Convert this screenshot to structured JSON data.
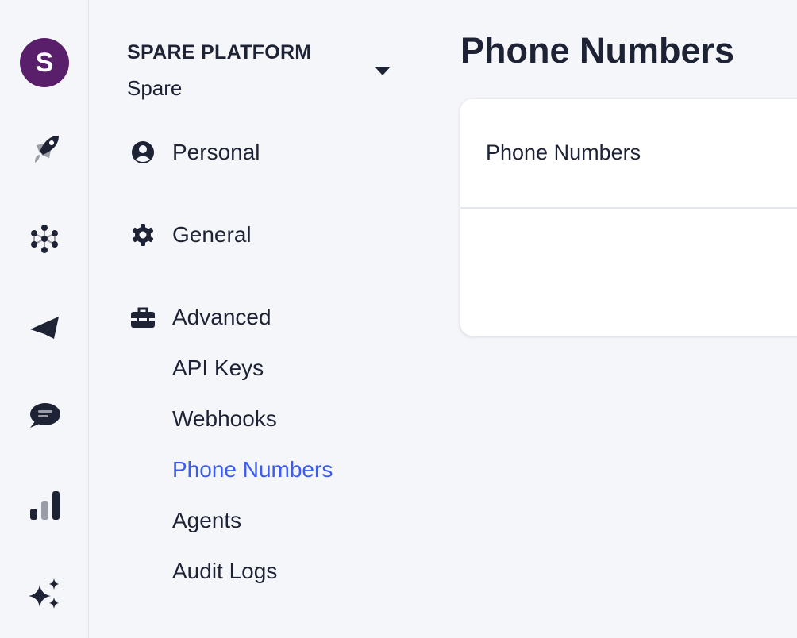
{
  "rail": {
    "avatar_letter": "S",
    "avatar_color": "#5a1f6b",
    "icons": [
      "rocket-icon",
      "network-icon",
      "paper-plane-icon",
      "chat-bubble-icon",
      "bar-chart-icon",
      "sparkles-icon"
    ]
  },
  "sidebar": {
    "org_name": "SPARE PLATFORM",
    "org_sub": "Spare",
    "sections": [
      {
        "label": "Personal",
        "icon": "user-circle-icon"
      },
      {
        "label": "General",
        "icon": "gear-icon"
      },
      {
        "label": "Advanced",
        "icon": "toolbox-icon"
      }
    ],
    "advanced_items": [
      {
        "label": "API Keys"
      },
      {
        "label": "Webhooks"
      },
      {
        "label": "Phone Numbers",
        "active": true
      },
      {
        "label": "Agents"
      },
      {
        "label": "Audit Logs"
      }
    ]
  },
  "main": {
    "title": "Phone Numbers",
    "card_title": "Phone Numbers"
  },
  "colors": {
    "text": "#1e2235",
    "accent": "#3b5bf6",
    "background": "#f5f6fa"
  }
}
